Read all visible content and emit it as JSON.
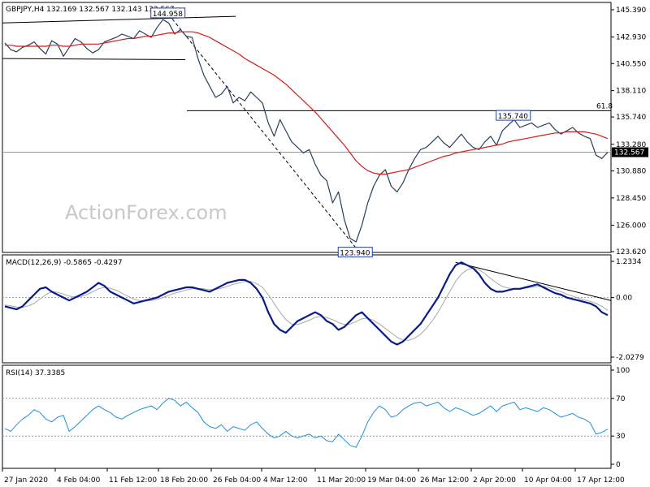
{
  "chart_data": [
    {
      "type": "line",
      "panel": "price",
      "header": "GBPJPY,H4  132.169 132.567 132.143 132.567",
      "watermark": "ActionForex.com",
      "y_ticks": [
        "145.390",
        "142.930",
        "140.550",
        "138.110",
        "135.740",
        "133.280",
        "130.880",
        "128.450",
        "126.000",
        "123.620"
      ],
      "ylim": [
        123.62,
        145.39
      ],
      "x_ticks": [
        "27 Jan 2020",
        "4 Feb 04:00",
        "11 Feb 12:00",
        "18 Feb 20:00",
        "26 Feb 04:00",
        "4 Mar 12:00",
        "11 Mar 20:00",
        "19 Mar 04:00",
        "26 Mar 12:00",
        "2 Apr 20:00",
        "10 Apr 04:00",
        "17 Apr 12:00"
      ],
      "last_price": "132.567",
      "last_price_value": 132.567,
      "fib_label": "61.8",
      "fib_level": 136.3,
      "annotations": [
        {
          "text": "144.958",
          "x": "18 Feb 20:00",
          "y": 144.958
        },
        {
          "text": "123.940",
          "x": "19 Mar 04:00",
          "y": 123.94
        },
        {
          "text": "135.740",
          "x": "2 Apr 20:00",
          "y": 135.74
        }
      ],
      "series": [
        {
          "values": [
            142.4,
            141.8,
            141.6,
            142.0,
            142.2,
            142.5,
            141.9,
            141.4,
            142.6,
            142.3,
            141.2,
            142.0,
            142.8,
            142.5,
            141.9,
            141.5,
            141.8,
            142.5,
            142.7,
            142.9,
            143.2,
            143.0,
            142.8,
            143.5,
            143.2,
            142.9,
            143.8,
            144.5,
            144.2,
            143.2,
            143.6,
            143.0,
            142.9,
            141.0,
            139.5,
            138.5,
            137.5,
            137.8,
            138.5,
            137.0,
            137.5,
            137.2,
            138.0,
            137.5,
            137.0,
            135.2,
            134.0,
            135.5,
            134.5,
            133.5,
            133.0,
            132.5,
            132.8,
            131.5,
            130.5,
            130.0,
            128.0,
            129.0,
            126.5,
            124.8,
            124.5,
            126.0,
            128.0,
            129.5,
            130.5,
            131.0,
            129.5,
            129.0,
            129.8,
            131.0,
            132.0,
            132.8,
            133.0,
            133.5,
            134.0,
            133.4,
            133.0,
            133.6,
            134.2,
            133.5,
            133.0,
            132.8,
            133.5,
            134.0,
            133.2,
            134.5,
            135.0,
            135.5,
            134.8,
            135.0,
            135.2,
            134.8,
            135.0,
            135.2,
            134.6,
            134.2,
            134.5,
            134.8,
            134.3,
            134.0,
            133.8,
            132.3,
            132.0,
            132.567
          ]
        },
        {
          "values": [
            142.2,
            142.2,
            142.1,
            142.1,
            142.1,
            142.1,
            142.1,
            142.1,
            142.2,
            142.2,
            142.1,
            142.1,
            142.2,
            142.3,
            142.3,
            142.3,
            142.3,
            142.4,
            142.5,
            142.6,
            142.7,
            142.8,
            142.8,
            142.9,
            143.0,
            143.0,
            143.1,
            143.2,
            143.3,
            143.3,
            143.4,
            143.4,
            143.4,
            143.3,
            143.1,
            142.9,
            142.6,
            142.3,
            142.0,
            141.7,
            141.4,
            141.0,
            140.7,
            140.4,
            140.1,
            139.8,
            139.5,
            139.1,
            138.7,
            138.2,
            137.7,
            137.2,
            136.7,
            136.2,
            135.6,
            135.0,
            134.4,
            133.8,
            133.2,
            132.5,
            131.8,
            131.3,
            130.9,
            130.7,
            130.6,
            130.6,
            130.7,
            130.8,
            130.9,
            131.0,
            131.2,
            131.4,
            131.6,
            131.8,
            132.0,
            132.2,
            132.3,
            132.5,
            132.6,
            132.7,
            132.8,
            132.9,
            133.0,
            133.1,
            133.2,
            133.3,
            133.5,
            133.6,
            133.7,
            133.8,
            133.9,
            134.0,
            134.1,
            134.2,
            134.3,
            134.3,
            134.4,
            134.4,
            134.4,
            134.4,
            134.3,
            134.2,
            134.0,
            133.8
          ]
        }
      ]
    },
    {
      "type": "line",
      "panel": "macd",
      "header": "MACD(12,26,9) -0.5865 -0.4297",
      "y_ticks": [
        "1.2334",
        "0.00",
        "-2.0279"
      ],
      "ylim": [
        -2.0279,
        1.2334
      ],
      "series": [
        {
          "values": [
            -0.3,
            -0.35,
            -0.4,
            -0.3,
            -0.1,
            0.1,
            0.3,
            0.35,
            0.2,
            0.1,
            0.0,
            -0.1,
            0.0,
            0.1,
            0.2,
            0.35,
            0.5,
            0.4,
            0.2,
            0.1,
            0.0,
            -0.1,
            -0.2,
            -0.15,
            -0.1,
            -0.05,
            0.0,
            0.1,
            0.2,
            0.25,
            0.3,
            0.35,
            0.35,
            0.3,
            0.25,
            0.2,
            0.3,
            0.4,
            0.5,
            0.55,
            0.6,
            0.6,
            0.5,
            0.3,
            0.0,
            -0.5,
            -0.9,
            -1.1,
            -1.2,
            -1.0,
            -0.8,
            -0.7,
            -0.6,
            -0.5,
            -0.6,
            -0.8,
            -0.9,
            -1.1,
            -1.0,
            -0.8,
            -0.6,
            -0.5,
            -0.7,
            -0.9,
            -1.1,
            -1.3,
            -1.5,
            -1.6,
            -1.5,
            -1.3,
            -1.1,
            -0.9,
            -0.6,
            -0.3,
            0.0,
            0.4,
            0.8,
            1.1,
            1.2,
            1.1,
            1.0,
            0.8,
            0.5,
            0.3,
            0.2,
            0.2,
            0.25,
            0.3,
            0.3,
            0.35,
            0.4,
            0.45,
            0.35,
            0.25,
            0.15,
            0.1,
            0.0,
            -0.05,
            -0.1,
            -0.15,
            -0.2,
            -0.3,
            -0.5,
            -0.6
          ]
        },
        {
          "values": [
            -0.25,
            -0.28,
            -0.32,
            -0.33,
            -0.28,
            -0.2,
            -0.05,
            0.1,
            0.2,
            0.18,
            0.12,
            0.05,
            0.02,
            0.04,
            0.1,
            0.2,
            0.3,
            0.35,
            0.32,
            0.25,
            0.15,
            0.05,
            -0.05,
            -0.1,
            -0.12,
            -0.1,
            -0.06,
            0.0,
            0.08,
            0.15,
            0.2,
            0.26,
            0.3,
            0.31,
            0.3,
            0.27,
            0.28,
            0.32,
            0.38,
            0.45,
            0.5,
            0.55,
            0.55,
            0.48,
            0.35,
            0.1,
            -0.2,
            -0.5,
            -0.75,
            -0.9,
            -0.92,
            -0.85,
            -0.77,
            -0.68,
            -0.64,
            -0.68,
            -0.75,
            -0.85,
            -0.92,
            -0.9,
            -0.82,
            -0.72,
            -0.7,
            -0.78,
            -0.9,
            -1.05,
            -1.2,
            -1.35,
            -1.45,
            -1.45,
            -1.38,
            -1.25,
            -1.05,
            -0.8,
            -0.5,
            -0.15,
            0.2,
            0.55,
            0.8,
            0.95,
            1.0,
            0.95,
            0.82,
            0.65,
            0.5,
            0.38,
            0.32,
            0.3,
            0.3,
            0.32,
            0.35,
            0.38,
            0.38,
            0.34,
            0.27,
            0.2,
            0.12,
            0.05,
            -0.02,
            -0.08,
            -0.13,
            -0.2,
            -0.3,
            -0.43
          ]
        }
      ]
    },
    {
      "type": "line",
      "panel": "rsi",
      "header": "RSI(14) 37.3385",
      "y_ticks": [
        "100",
        "70",
        "30",
        "0"
      ],
      "ylim": [
        0,
        100
      ],
      "levels": [
        70,
        30
      ],
      "series": [
        {
          "values": [
            38,
            35,
            42,
            48,
            52,
            58,
            55,
            48,
            45,
            50,
            52,
            35,
            40,
            46,
            52,
            58,
            62,
            58,
            55,
            50,
            48,
            52,
            55,
            58,
            60,
            62,
            58,
            65,
            70,
            68,
            62,
            66,
            60,
            55,
            45,
            40,
            38,
            42,
            35,
            40,
            38,
            36,
            42,
            45,
            38,
            32,
            28,
            30,
            35,
            30,
            28,
            30,
            32,
            28,
            30,
            25,
            24,
            32,
            26,
            20,
            18,
            30,
            45,
            55,
            62,
            58,
            50,
            52,
            58,
            62,
            65,
            66,
            62,
            64,
            66,
            60,
            56,
            60,
            58,
            55,
            52,
            54,
            58,
            62,
            56,
            62,
            64,
            66,
            58,
            60,
            58,
            56,
            60,
            58,
            54,
            50,
            52,
            54,
            50,
            48,
            44,
            32,
            34,
            37.3385
          ]
        }
      ]
    }
  ]
}
